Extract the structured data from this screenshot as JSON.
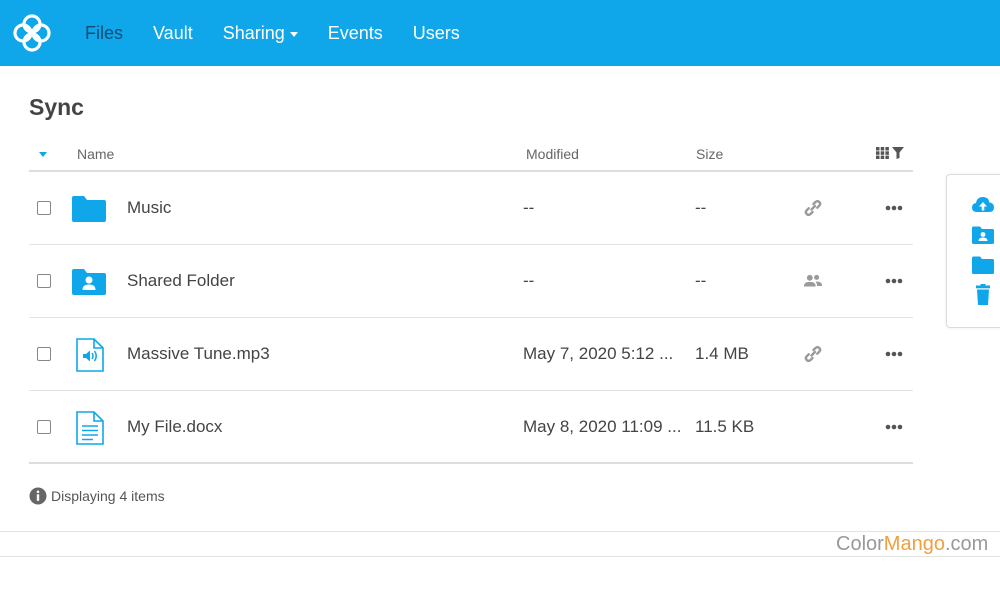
{
  "nav": {
    "items": [
      {
        "label": "Files"
      },
      {
        "label": "Vault"
      },
      {
        "label": "Sharing"
      },
      {
        "label": "Events"
      },
      {
        "label": "Users"
      }
    ]
  },
  "page": {
    "title": "Sync"
  },
  "table": {
    "headers": {
      "name": "Name",
      "modified": "Modified",
      "size": "Size"
    },
    "rows": [
      {
        "name": "Music",
        "modified": "--",
        "size": "--",
        "icon": "folder-icon",
        "share": "link-icon"
      },
      {
        "name": "Shared Folder",
        "modified": "--",
        "size": "--",
        "icon": "shared-folder-icon",
        "share": "users-icon"
      },
      {
        "name": "Massive Tune.mp3",
        "modified": "May 7, 2020 5:12 ...",
        "size": "1.4 MB",
        "icon": "audio-file-icon",
        "share": "link-icon"
      },
      {
        "name": "My File.docx",
        "modified": "May 8, 2020 11:09 ...",
        "size": "11.5 KB",
        "icon": "document-file-icon",
        "share": ""
      }
    ]
  },
  "footer": {
    "status": "Displaying 4 items"
  },
  "side_actions": [
    "upload-icon",
    "new-shared-folder-icon",
    "new-folder-icon",
    "trash-icon"
  ],
  "watermark": {
    "part1": "Color",
    "part2": "Mango",
    "part3": ".com"
  },
  "colors": {
    "accent": "#0fa7ea",
    "active_nav": "#0e4d78",
    "muted_icon": "#9a9a9a"
  }
}
